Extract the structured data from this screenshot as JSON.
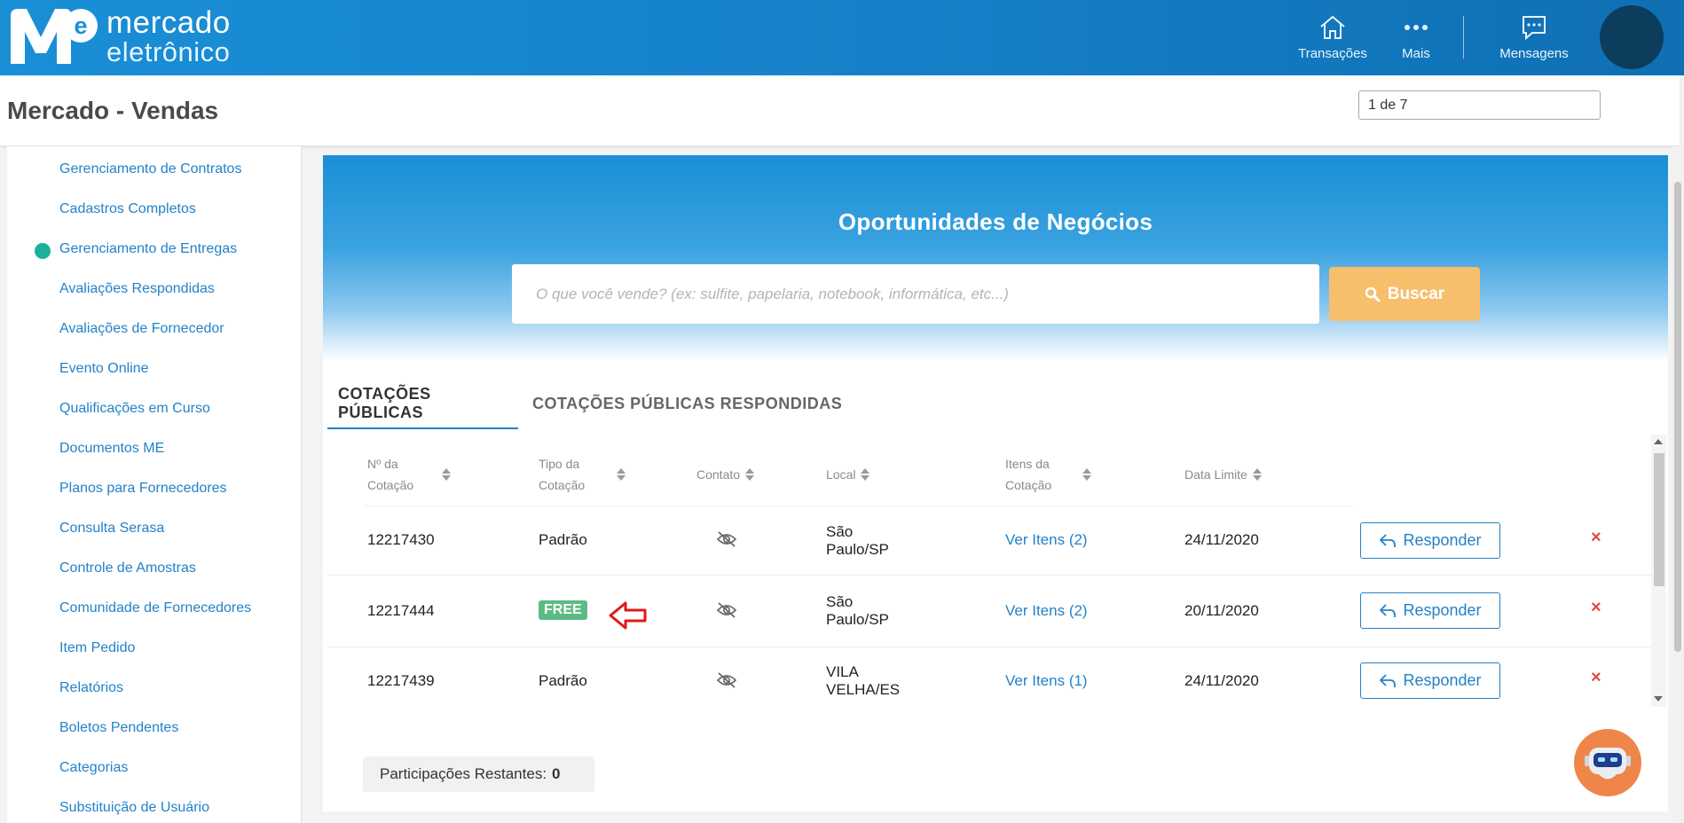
{
  "brand": {
    "line1": "mercado",
    "line2": "eletrônico"
  },
  "nav": [
    {
      "label": "Transações",
      "icon": "home-icon"
    },
    {
      "label": "Mais",
      "icon": "more-dots-icon"
    },
    {
      "label": "Mensagens",
      "icon": "chat-icon"
    }
  ],
  "page": {
    "title": "Mercado - Vendas",
    "pager_value": "1 de 7"
  },
  "sidebar": {
    "items": [
      "Gerenciamento de Contratos",
      "Cadastros Completos",
      "Gerenciamento de Entregas",
      "Avaliações Respondidas",
      "Avaliações de Fornecedor",
      "Evento Online",
      "Qualificações em Curso",
      "Documentos ME",
      "Planos para Fornecedores",
      "Consulta Serasa",
      "Controle de Amostras",
      "Comunidade de Fornecedores",
      "Item Pedido",
      "Relatórios",
      "Boletos Pendentes",
      "Categorias",
      "Substituição de Usuário"
    ],
    "active_index": 2
  },
  "hero": {
    "title": "Oportunidades de Negócios",
    "search_placeholder": "O que você vende? (ex: sulfite, papelaria, notebook, informática, etc...)",
    "search_button": "Buscar"
  },
  "tabs": [
    "COTAÇÕES PÚBLICAS",
    "COTAÇÕES PÚBLICAS RESPONDIDAS"
  ],
  "table": {
    "headers": {
      "numero_l1": "Nº da",
      "numero_l2": "Cotação",
      "tipo_l1": "Tipo da",
      "tipo_l2": "Cotação",
      "contato": "Contato",
      "local": "Local",
      "itens_l1": "Itens da",
      "itens_l2": "Cotação",
      "data": "Data Limite"
    },
    "rows": [
      {
        "numero": "12217430",
        "tipo": "Padrão",
        "local_l1": "São",
        "local_l2": "Paulo/SP",
        "itens": "Ver Itens (2)",
        "data": "24/11/2020",
        "action": "Responder",
        "delete": "×"
      },
      {
        "numero": "12217444",
        "tipo": "FREE",
        "local_l1": "São",
        "local_l2": "Paulo/SP",
        "itens": "Ver Itens (2)",
        "data": "20/11/2020",
        "action": "Responder",
        "delete": "×"
      },
      {
        "numero": "12217439",
        "tipo": "Padrão",
        "local_l1": "VILA",
        "local_l2": "VELHA/ES",
        "itens": "Ver Itens (1)",
        "data": "24/11/2020",
        "action": "Responder",
        "delete": "×"
      }
    ]
  },
  "participations": {
    "label": "Participações Restantes:",
    "value": "0"
  },
  "colors": {
    "brand_blue": "#1a8fd6",
    "link": "#2382c8",
    "search_button": "#f7be6b",
    "free_badge": "#5cbb84",
    "delete": "#e14848",
    "active_dot": "#18b39a",
    "annotation_arrow": "#e01818"
  }
}
